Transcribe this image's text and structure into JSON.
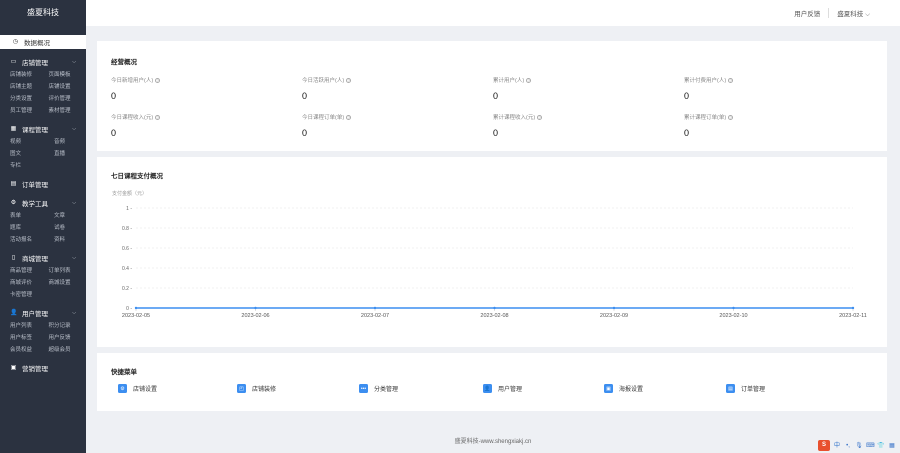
{
  "sidebar": {
    "brand": "盛夏科技",
    "active": "数据概况",
    "sections": [
      {
        "title": "店铺管理",
        "items": [
          "店铺装修",
          "页面模板",
          "店铺主题",
          "店铺设置",
          "分类设置",
          "评价管理",
          "员工管理",
          "素材管理"
        ]
      },
      {
        "title": "课程管理",
        "items": [
          "视频",
          "音频",
          "图文",
          "直播",
          "专栏"
        ]
      },
      {
        "title": "订单管理",
        "items": []
      },
      {
        "title": "教学工具",
        "items": [
          "表单",
          "文章",
          "题库",
          "试卷",
          "活动报名",
          "资料"
        ]
      },
      {
        "title": "商城管理",
        "items": [
          "商品管理",
          "订单列表",
          "商城评价",
          "商城设置",
          "卡密管理"
        ]
      },
      {
        "title": "用户管理",
        "items": [
          "用户列表",
          "积分记录",
          "用户标签",
          "用户反馈",
          "会员权益",
          "超级会员"
        ]
      },
      {
        "title": "营销管理",
        "items": []
      }
    ]
  },
  "topbar": {
    "feedback": "用户反馈",
    "company": "盛夏科技"
  },
  "ops": {
    "title": "经营概况",
    "metrics": [
      {
        "label": "今日新增用户(人)",
        "value": "0"
      },
      {
        "label": "今日活跃用户(人)",
        "value": "0"
      },
      {
        "label": "累计用户(人)",
        "value": "0"
      },
      {
        "label": "累计付费用户(人)",
        "value": "0"
      },
      {
        "label": "今日课程收入(元)",
        "value": "0"
      },
      {
        "label": "今日课程订单(单)",
        "value": "0"
      },
      {
        "label": "累计课程收入(元)",
        "value": "0"
      },
      {
        "label": "累计课程订单(单)",
        "value": "0"
      }
    ]
  },
  "pay": {
    "title": "七日课程支付概况",
    "unit": "支付金额（元）"
  },
  "chart_data": {
    "type": "line",
    "title": "七日课程支付概况",
    "ylabel": "支付金额（元）",
    "xlabel": "",
    "x": [
      "2023-02-05",
      "2023-02-06",
      "2023-02-07",
      "2023-02-08",
      "2023-02-09",
      "2023-02-10",
      "2023-02-11"
    ],
    "series": [
      {
        "values": [
          0,
          0,
          0,
          0,
          0,
          0,
          0
        ]
      }
    ],
    "yticks": [
      "0",
      "0.2",
      "0.4",
      "0.6",
      "0.8",
      "1"
    ],
    "ylim": [
      0,
      1
    ],
    "grid": true,
    "color": "#3c8ef0"
  },
  "quick": {
    "title": "快捷菜单",
    "items": [
      {
        "label": "店铺设置",
        "icon": "gear-icon"
      },
      {
        "label": "店铺装修",
        "icon": "decorate-icon"
      },
      {
        "label": "分类管理",
        "icon": "more-icon"
      },
      {
        "label": "用户管理",
        "icon": "user-icon"
      },
      {
        "label": "海报设置",
        "icon": "poster-icon"
      },
      {
        "label": "订单管理",
        "icon": "order-icon"
      }
    ]
  },
  "footer": "盛夏科技-www.shengxiakj.cn",
  "tray": {
    "ime": "中"
  }
}
